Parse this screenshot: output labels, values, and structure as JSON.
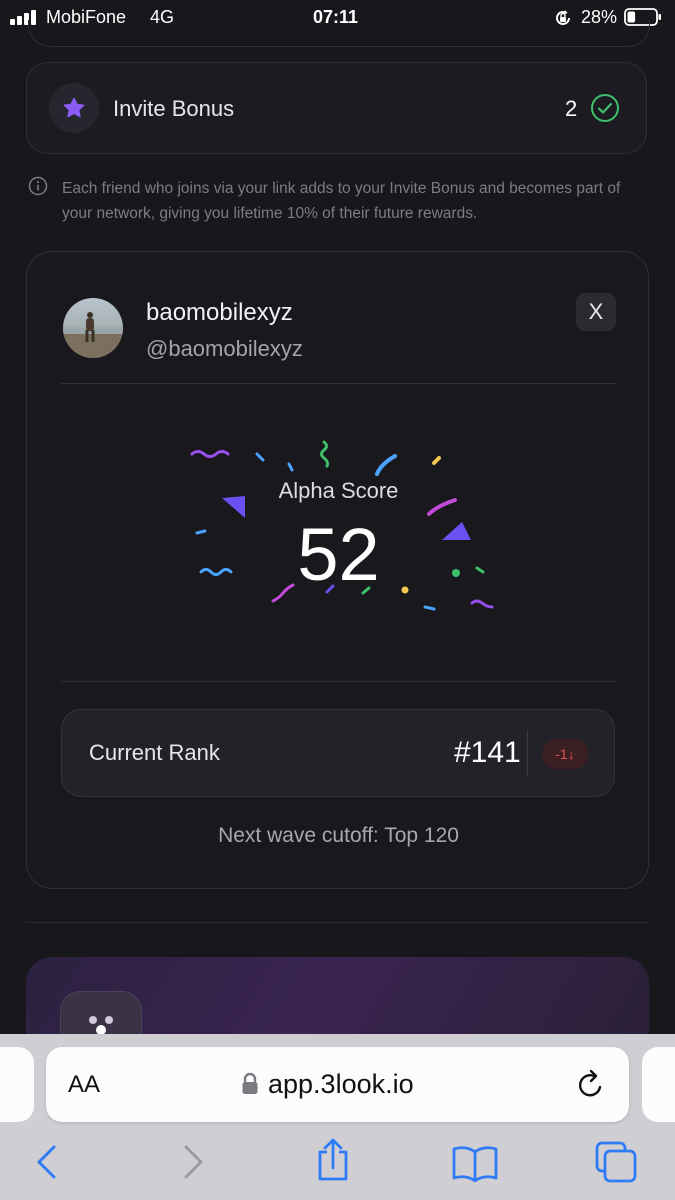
{
  "status_bar": {
    "carrier": "MobiFone",
    "network": "4G",
    "time": "07:11",
    "battery_percent": "28%",
    "battery_level": 0.28
  },
  "invite_bonus": {
    "label": "Invite Bonus",
    "count": "2",
    "icon": "star-icon",
    "status_icon": "check-circle-icon"
  },
  "info": {
    "text": "Each friend who joins via your link adds to your Invite Bonus and becomes part of your network, giving you lifetime 10% of their future rewards."
  },
  "profile": {
    "username": "baomobilexyz",
    "handle": "@baomobilexyz",
    "social_icon": "X",
    "score_label": "Alpha Score",
    "score_value": "52",
    "rank_label": "Current Rank",
    "rank_value": "#141",
    "rank_delta": "-1↓",
    "cutoff_text": "Next wave cutoff: Top 120"
  },
  "browser": {
    "text_size_button": "AA",
    "url": "app.3look.io"
  },
  "colors": {
    "background": "#17171c",
    "accent_purple": "#8a5cf6",
    "success_green": "#3fbf6a",
    "negative_red": "#e25252"
  }
}
